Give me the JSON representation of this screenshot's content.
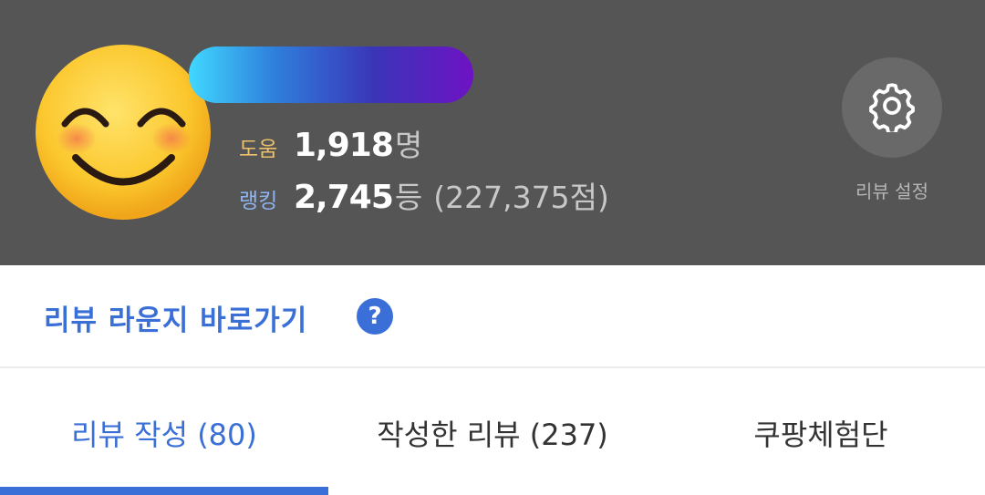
{
  "profile": {
    "avatar_icon": "smiling-face-emoji",
    "helps_label": "도움",
    "helps_value": "1,918",
    "helps_unit": "명",
    "rank_label": "랭킹",
    "rank_value": "2,745",
    "rank_unit": "등",
    "rank_points": "(227,375점)"
  },
  "settings": {
    "icon": "gear-icon",
    "label": "리뷰 설정"
  },
  "lounge": {
    "link_text": "리뷰 라운지 바로가기",
    "help_icon_text": "?"
  },
  "tabs": [
    {
      "label": "리뷰 작성 (80)",
      "active": true
    },
    {
      "label": "작성한 리뷰 (237)",
      "active": false
    },
    {
      "label": "쿠팡체험단",
      "active": false
    }
  ],
  "colors": {
    "header_bg": "#555555",
    "accent": "#3a6fd8",
    "helps_label": "#ecc06b",
    "rank_label": "#8fb4f2"
  }
}
